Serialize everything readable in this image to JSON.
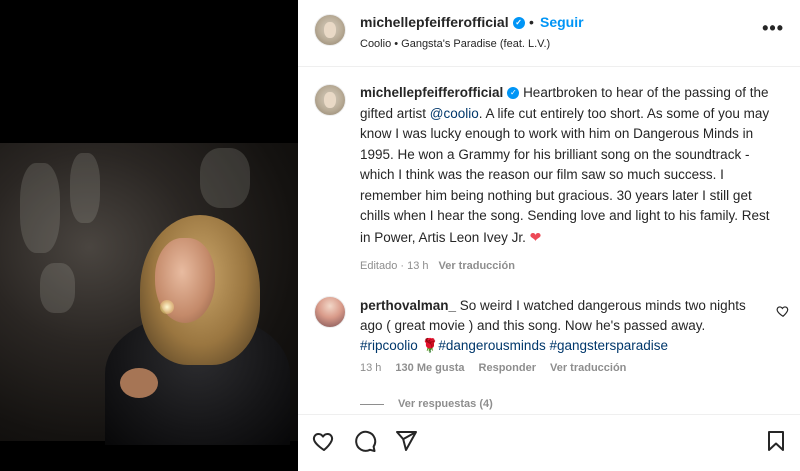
{
  "header": {
    "username": "michellepfeifferofficial",
    "separator": "•",
    "follow_label": "Seguir",
    "audio": "Coolio • Gangsta's Paradise (feat. L.V.)",
    "more_label": "•••"
  },
  "caption": {
    "username": "michellepfeifferofficial",
    "text_before_mention": "Heartbroken to hear of the passing of the gifted artist ",
    "mention": "@coolio",
    "text_after_mention": ". A life cut entirely too short. As some of you may know I was lucky enough to work with him on Dangerous Minds in 1995. He won a Grammy for his brilliant song on the soundtrack - which I think was the reason our film saw so much success. I remember him being nothing but gracious. 30 years later I still get chills when I hear the song. Sending love and light to his family. Rest in Power, Artis Leon Ivey Jr. ",
    "heart": "❤",
    "edited": "Editado · 13 h",
    "translate_label": "Ver traducción"
  },
  "comment": {
    "username": "perthovalman_",
    "text": "So weird I watched dangerous minds two nights ago ( great movie ) and this song. Now he's passed away. ",
    "hashtag1": "#ripcoolio",
    "rose": "🌹",
    "hashtag2": "#dangerousminds",
    "hashtag3": "#gangstersparadise",
    "time": "13 h",
    "likes": "130 Me gusta",
    "reply_label": "Responder",
    "translate_label": "Ver traducción",
    "view_replies": "Ver respuestas (4)"
  },
  "icons": {
    "like": "heart-outline-icon",
    "comment": "comment-bubble-icon",
    "share": "paper-plane-icon",
    "save": "bookmark-icon"
  },
  "colors": {
    "link_blue": "#0095f6",
    "mention_blue": "#00376b",
    "meta_gray": "#8e8e8e",
    "verified_blue": "#0095f6"
  }
}
